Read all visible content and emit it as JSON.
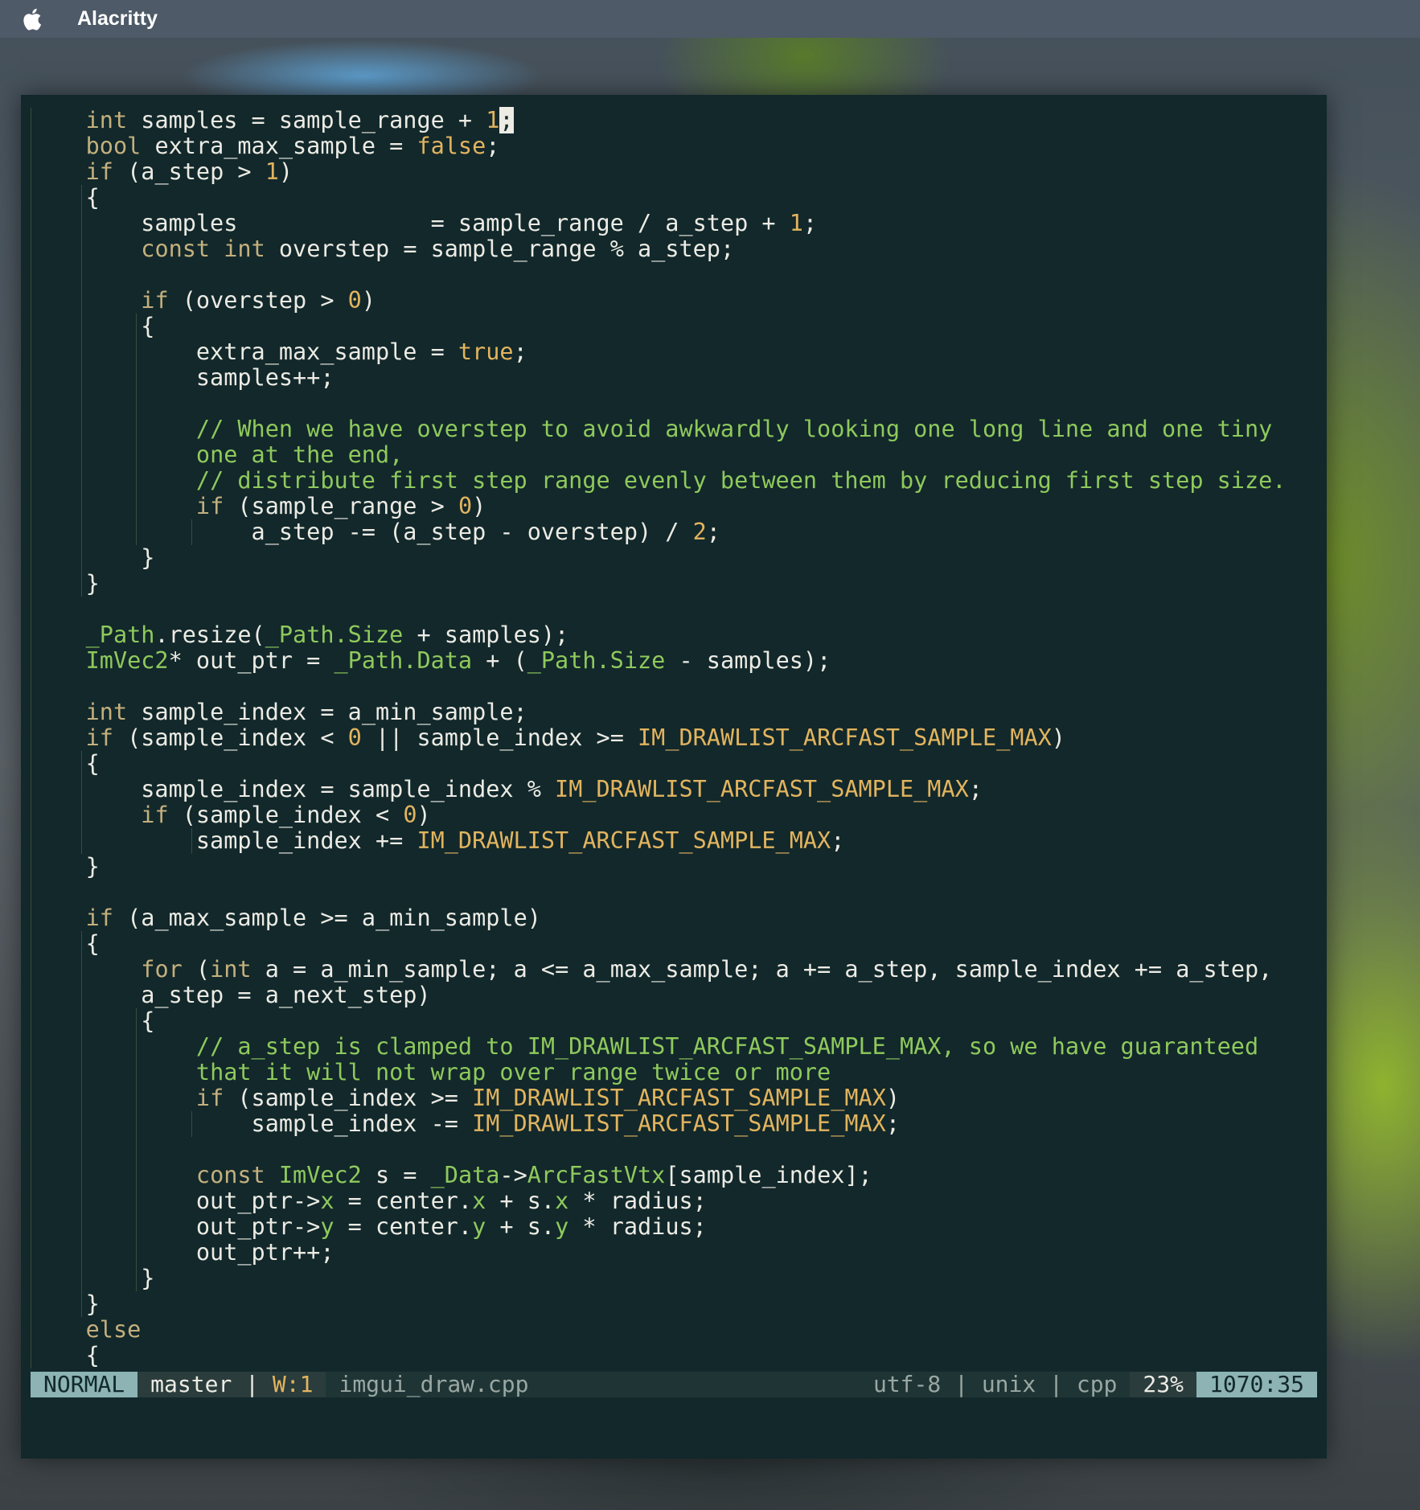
{
  "menubar": {
    "app_name": "Alacritty",
    "icon": "apple-icon"
  },
  "colors": {
    "terminal_bg": "#12282b",
    "text": "#ecebe4",
    "keyword": "#c4b07d",
    "number": "#e2b45e",
    "comment": "#8fc95c",
    "type": "#8fc95c",
    "status_mode_bg": "#8db3b4"
  },
  "code_lines": [
    [
      {
        "s": "    "
      },
      {
        "s": "int",
        "c": "k"
      },
      {
        "s": " samples = sample_range + "
      },
      {
        "s": "1",
        "c": "n"
      },
      {
        "s": ";",
        "c": "cursor"
      }
    ],
    [
      {
        "s": "    "
      },
      {
        "s": "bool",
        "c": "k"
      },
      {
        "s": " extra_max_sample = "
      },
      {
        "s": "false",
        "c": "n"
      },
      {
        "s": ";"
      }
    ],
    [
      {
        "s": "    "
      },
      {
        "s": "if",
        "c": "k"
      },
      {
        "s": " (a_step > "
      },
      {
        "s": "1",
        "c": "n"
      },
      {
        "s": ")"
      }
    ],
    [
      {
        "s": "    {"
      }
    ],
    [
      {
        "s": "        samples              = sample_range / a_step + "
      },
      {
        "s": "1",
        "c": "n"
      },
      {
        "s": ";"
      }
    ],
    [
      {
        "s": "        "
      },
      {
        "s": "const",
        "c": "k"
      },
      {
        "s": " "
      },
      {
        "s": "int",
        "c": "k"
      },
      {
        "s": " overstep = sample_range % a_step;"
      }
    ],
    [
      {
        "s": ""
      }
    ],
    [
      {
        "s": "        "
      },
      {
        "s": "if",
        "c": "k"
      },
      {
        "s": " (overstep > "
      },
      {
        "s": "0",
        "c": "n"
      },
      {
        "s": ")"
      }
    ],
    [
      {
        "s": "        {"
      }
    ],
    [
      {
        "s": "            extra_max_sample = "
      },
      {
        "s": "true",
        "c": "n"
      },
      {
        "s": ";"
      }
    ],
    [
      {
        "s": "            samples++;"
      }
    ],
    [
      {
        "s": ""
      }
    ],
    [
      {
        "s": "            "
      },
      {
        "s": "// When we have overstep to avoid awkwardly looking one long line and one tiny",
        "c": "c"
      }
    ],
    [
      {
        "s": "            "
      },
      {
        "s": "one at the end,",
        "c": "c"
      }
    ],
    [
      {
        "s": "            "
      },
      {
        "s": "// distribute first step range evenly between them by reducing first step size.",
        "c": "c"
      }
    ],
    [
      {
        "s": "            "
      },
      {
        "s": "if",
        "c": "k"
      },
      {
        "s": " (sample_range > "
      },
      {
        "s": "0",
        "c": "n"
      },
      {
        "s": ")"
      }
    ],
    [
      {
        "s": "                a_step -= (a_step - overstep) / "
      },
      {
        "s": "2",
        "c": "n"
      },
      {
        "s": ";"
      }
    ],
    [
      {
        "s": "        }"
      }
    ],
    [
      {
        "s": "    }"
      }
    ],
    [
      {
        "s": ""
      }
    ],
    [
      {
        "s": "    "
      },
      {
        "s": "_Path",
        "c": "ty"
      },
      {
        "s": ".resize("
      },
      {
        "s": "_Path.Size",
        "c": "ty"
      },
      {
        "s": " + samples);"
      }
    ],
    [
      {
        "s": "    "
      },
      {
        "s": "ImVec2",
        "c": "ty"
      },
      {
        "s": "* out_ptr = "
      },
      {
        "s": "_Path.Data",
        "c": "ty"
      },
      {
        "s": " + ("
      },
      {
        "s": "_Path.Size",
        "c": "ty"
      },
      {
        "s": " - samples);"
      }
    ],
    [
      {
        "s": ""
      }
    ],
    [
      {
        "s": "    "
      },
      {
        "s": "int",
        "c": "k"
      },
      {
        "s": " sample_index = a_min_sample;"
      }
    ],
    [
      {
        "s": "    "
      },
      {
        "s": "if",
        "c": "k"
      },
      {
        "s": " (sample_index < "
      },
      {
        "s": "0",
        "c": "n"
      },
      {
        "s": " || sample_index >= "
      },
      {
        "s": "IM_DRAWLIST_ARCFAST_SAMPLE_MAX",
        "c": "n"
      },
      {
        "s": ")"
      }
    ],
    [
      {
        "s": "    {"
      }
    ],
    [
      {
        "s": "        sample_index = sample_index % "
      },
      {
        "s": "IM_DRAWLIST_ARCFAST_SAMPLE_MAX",
        "c": "n"
      },
      {
        "s": ";"
      }
    ],
    [
      {
        "s": "        "
      },
      {
        "s": "if",
        "c": "k"
      },
      {
        "s": " (sample_index < "
      },
      {
        "s": "0",
        "c": "n"
      },
      {
        "s": ")"
      }
    ],
    [
      {
        "s": "            sample_index += "
      },
      {
        "s": "IM_DRAWLIST_ARCFAST_SAMPLE_MAX",
        "c": "n"
      },
      {
        "s": ";"
      }
    ],
    [
      {
        "s": "    }"
      }
    ],
    [
      {
        "s": ""
      }
    ],
    [
      {
        "s": "    "
      },
      {
        "s": "if",
        "c": "k"
      },
      {
        "s": " (a_max_sample >= a_min_sample)"
      }
    ],
    [
      {
        "s": "    {"
      }
    ],
    [
      {
        "s": "        "
      },
      {
        "s": "for",
        "c": "k"
      },
      {
        "s": " ("
      },
      {
        "s": "int",
        "c": "k"
      },
      {
        "s": " a = a_min_sample; a <= a_max_sample; a += a_step, sample_index += a_step,"
      }
    ],
    [
      {
        "s": "        a_step = a_next_step)"
      }
    ],
    [
      {
        "s": "        {"
      }
    ],
    [
      {
        "s": "            "
      },
      {
        "s": "// a_step is clamped to IM_DRAWLIST_ARCFAST_SAMPLE_MAX, so we have guaranteed",
        "c": "c"
      }
    ],
    [
      {
        "s": "            "
      },
      {
        "s": "that it will not wrap over range twice or more",
        "c": "c"
      }
    ],
    [
      {
        "s": "            "
      },
      {
        "s": "if",
        "c": "k"
      },
      {
        "s": " (sample_index >= "
      },
      {
        "s": "IM_DRAWLIST_ARCFAST_SAMPLE_MAX",
        "c": "n"
      },
      {
        "s": ")"
      }
    ],
    [
      {
        "s": "                sample_index -= "
      },
      {
        "s": "IM_DRAWLIST_ARCFAST_SAMPLE_MAX",
        "c": "n"
      },
      {
        "s": ";"
      }
    ],
    [
      {
        "s": ""
      }
    ],
    [
      {
        "s": "            "
      },
      {
        "s": "const",
        "c": "k"
      },
      {
        "s": " "
      },
      {
        "s": "ImVec2",
        "c": "ty"
      },
      {
        "s": " s = "
      },
      {
        "s": "_Data",
        "c": "ty"
      },
      {
        "s": "->"
      },
      {
        "s": "ArcFastVtx",
        "c": "ty"
      },
      {
        "s": "[sample_index];"
      }
    ],
    [
      {
        "s": "            out_ptr->"
      },
      {
        "s": "x",
        "c": "ty"
      },
      {
        "s": " = center."
      },
      {
        "s": "x",
        "c": "ty"
      },
      {
        "s": " + s."
      },
      {
        "s": "x",
        "c": "ty"
      },
      {
        "s": " * radius;"
      }
    ],
    [
      {
        "s": "            out_ptr->"
      },
      {
        "s": "y",
        "c": "ty"
      },
      {
        "s": " = center."
      },
      {
        "s": "y",
        "c": "ty"
      },
      {
        "s": " + s."
      },
      {
        "s": "y",
        "c": "ty"
      },
      {
        "s": " * radius;"
      }
    ],
    [
      {
        "s": "            out_ptr++;"
      }
    ],
    [
      {
        "s": "        }"
      }
    ],
    [
      {
        "s": "    }"
      }
    ],
    [
      {
        "s": "    "
      },
      {
        "s": "else",
        "c": "k"
      }
    ],
    [
      {
        "s": "    {"
      }
    ]
  ],
  "statusbar": {
    "mode": "NORMAL",
    "branch": "master",
    "separator": " | ",
    "warnings": "W:1",
    "filename": "imgui_draw.cpp",
    "encoding_info": "utf-8 | unix | cpp",
    "percent": "23%",
    "position": "1070:35"
  }
}
